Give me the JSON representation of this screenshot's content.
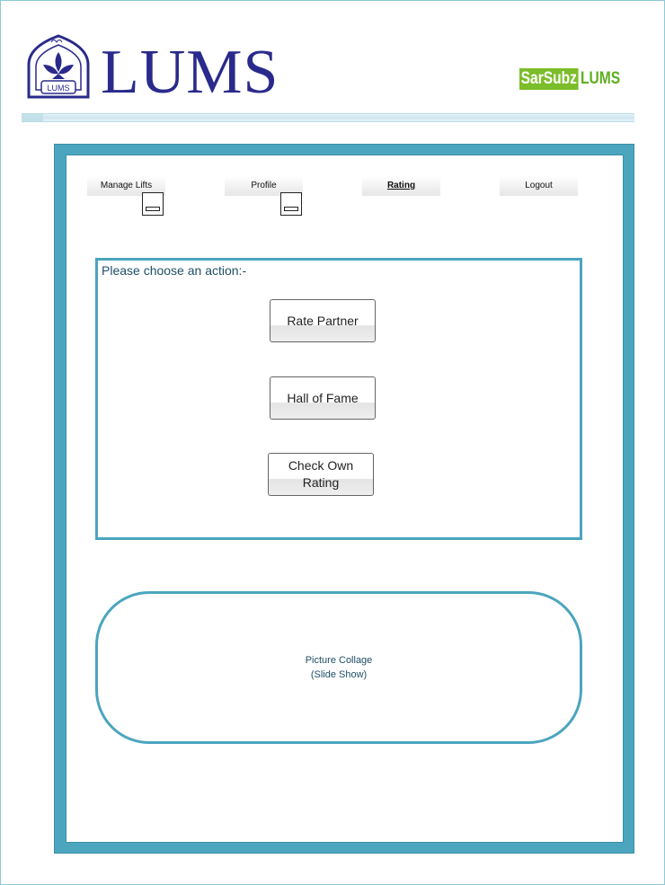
{
  "header": {
    "brand": "LUMS",
    "logo": {
      "icon": "lums-crest-icon",
      "label": "LUMS"
    },
    "partner_logo": {
      "part1": "SarSubz",
      "part2": "LUMS"
    }
  },
  "nav": {
    "tabs": [
      {
        "label": "Manage Lifts",
        "active": false
      },
      {
        "label": "Profile",
        "active": false
      },
      {
        "label": "Rating",
        "active": true
      },
      {
        "label": "Logout",
        "active": false
      }
    ]
  },
  "actions": {
    "prompt": "Please choose an action:-",
    "buttons": {
      "rate_partner": "Rate Partner",
      "hall_of_fame": "Hall of Fame",
      "check_own_rating": "Check Own Rating"
    }
  },
  "collage": {
    "line1": "Picture Collage",
    "line2": "(Slide Show)"
  },
  "colors": {
    "accent": "#4ba5bf",
    "brand_blue": "#2a2a8c",
    "partner_green": "#7cbd2a"
  }
}
